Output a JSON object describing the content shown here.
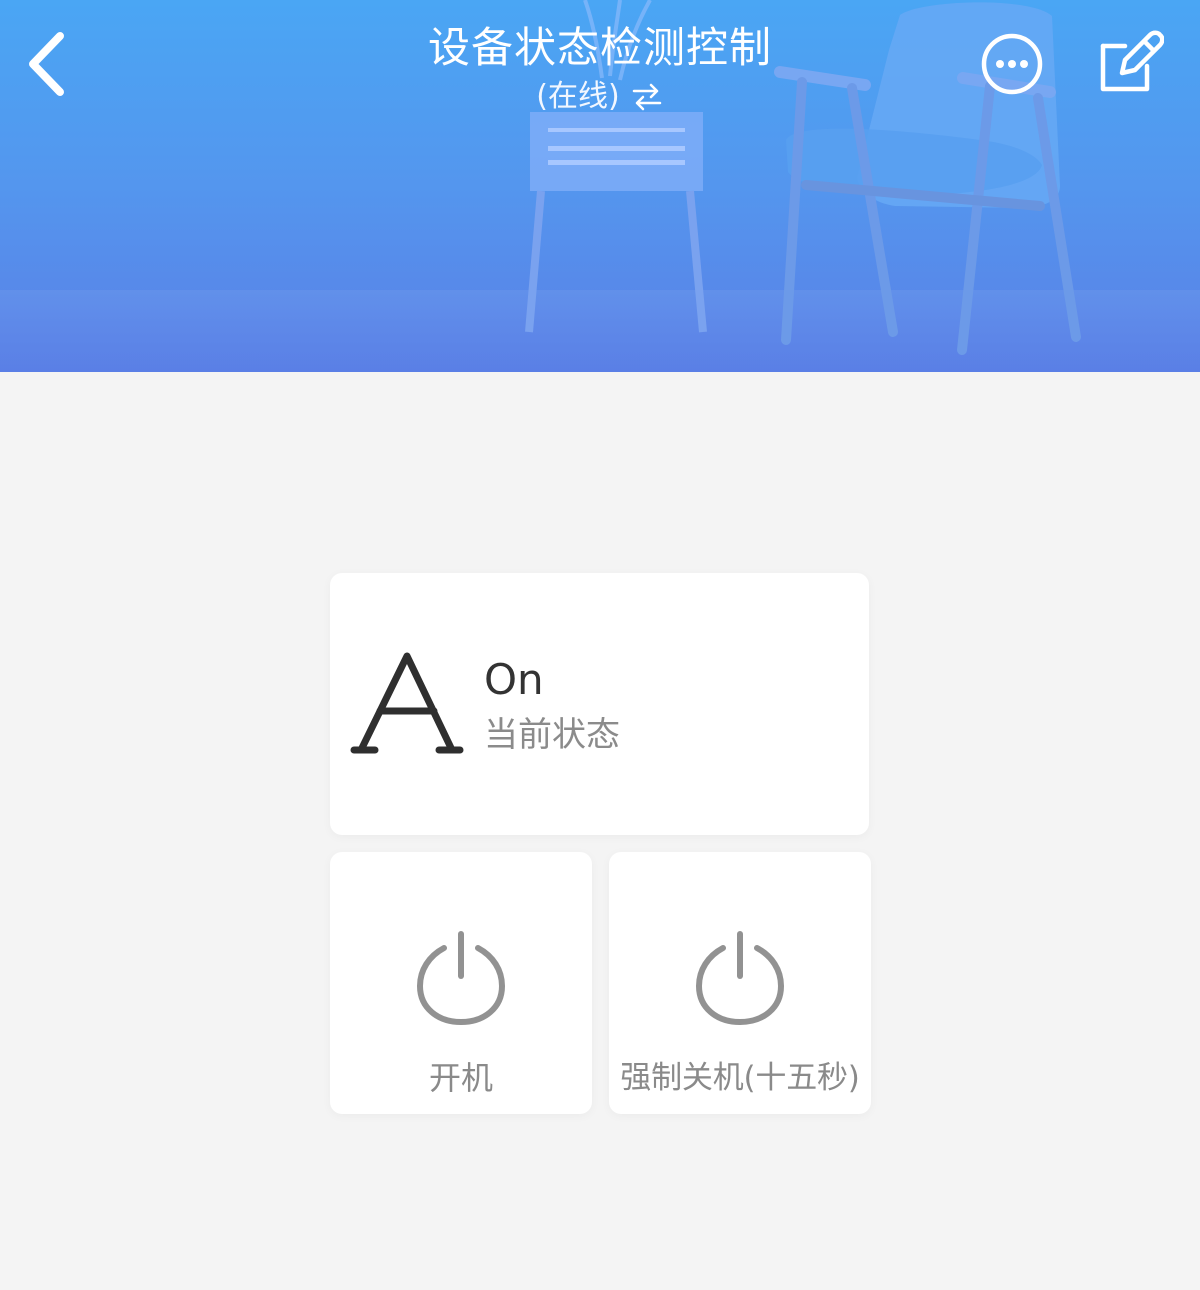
{
  "header": {
    "title": "设备状态检测控制",
    "subtitle": "(在线)",
    "background_colors": [
      "#4aa6f4",
      "#5496ee",
      "#5a7fe6"
    ],
    "icons": {
      "back": "chevron-left-icon",
      "swap": "swap-arrows-icon",
      "more": "more-options-icon",
      "edit": "edit-icon"
    }
  },
  "status": {
    "value": "On",
    "label": "当前状态",
    "icon": "letter-a-icon",
    "icon_text": "A"
  },
  "actions": {
    "power_on": {
      "label": "开机",
      "icon": "power-icon"
    },
    "force_off": {
      "label": "强制关机(十五秒)",
      "icon": "power-icon"
    }
  },
  "colors": {
    "page_background": "#f4f4f4",
    "card_background": "#ffffff",
    "text_primary": "#333333",
    "text_secondary": "#8b8b8b",
    "icon_gray": "#929292"
  }
}
